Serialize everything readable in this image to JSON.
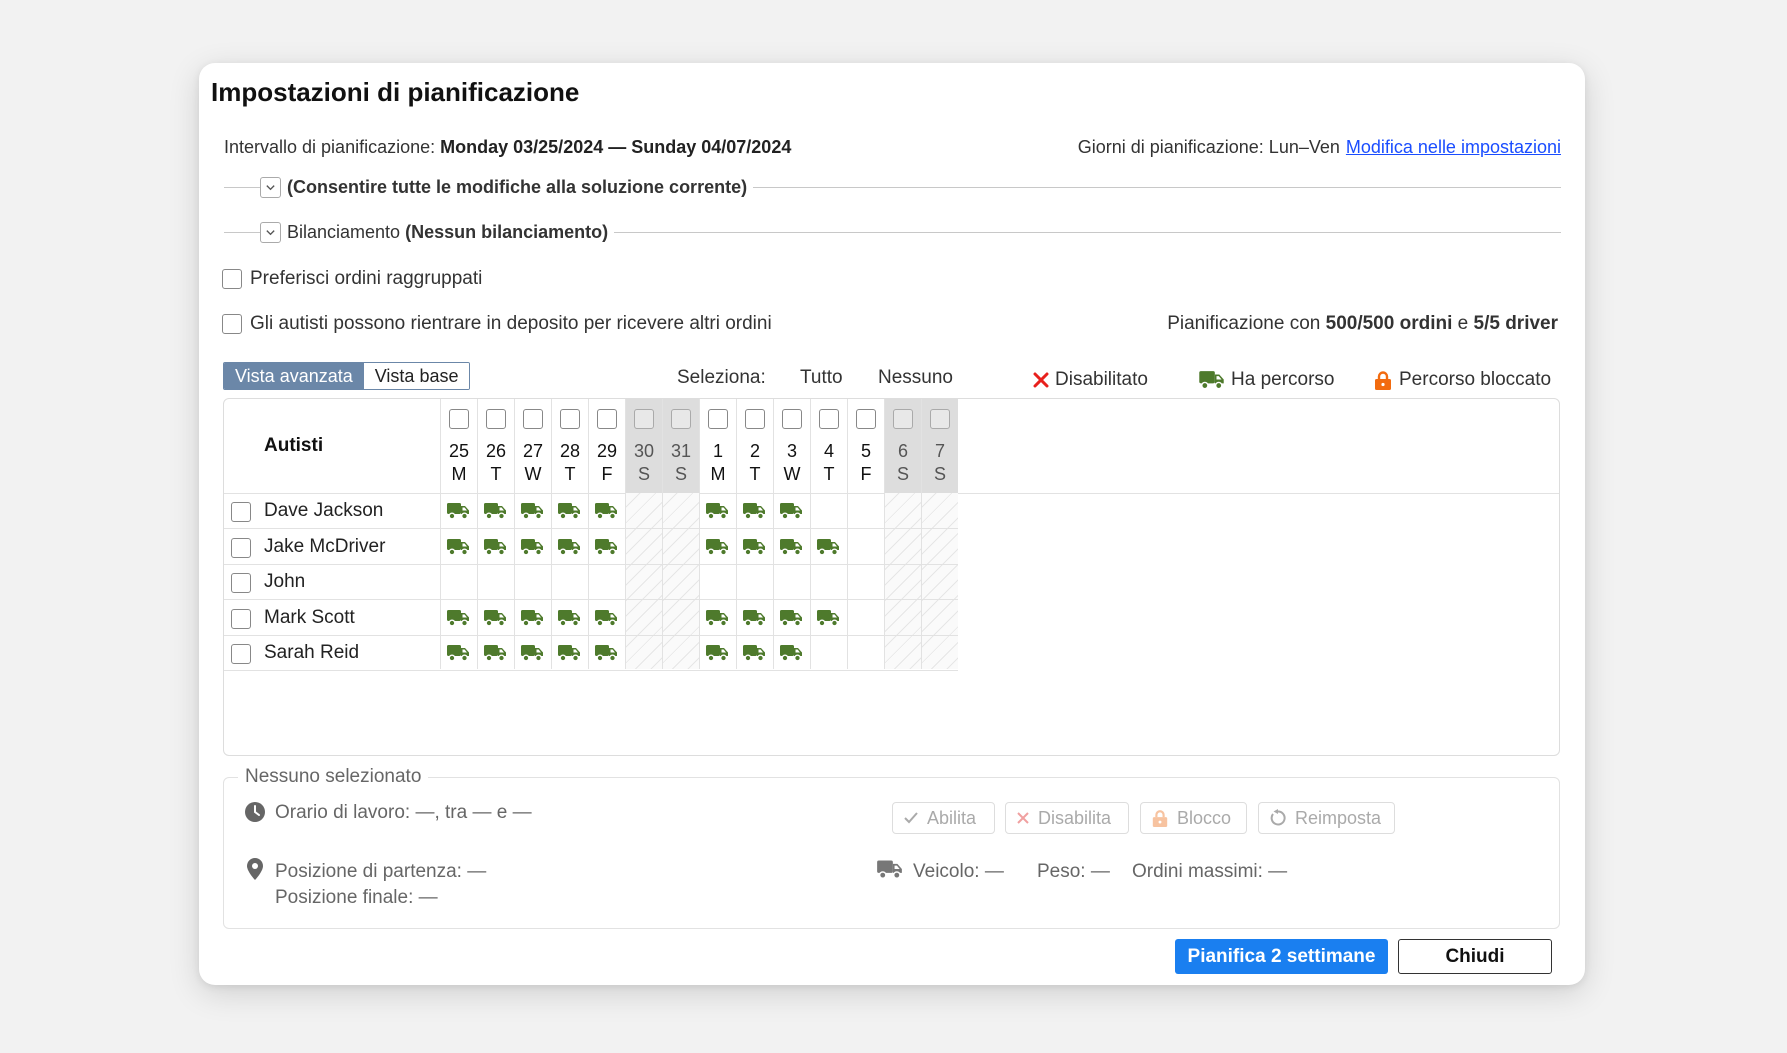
{
  "dialog": {
    "title": "Impostazioni di pianificazione",
    "interval_label": "Intervallo di pianificazione:",
    "interval_value": "Monday 03/25/2024 — Sunday 04/07/2024",
    "days_label": "Giorni di pianificazione: Lun–Ven",
    "edit_link": "Modifica nelle impostazioni"
  },
  "sections": {
    "changes": "(Consentire tutte le modifiche alla soluzione corrente)",
    "balancing_label": "Bilanciamento",
    "balancing_value": "(Nessun bilanciamento)"
  },
  "options": {
    "prefer_grouped": "Preferisci ordini raggruppati",
    "return_depot": "Gli autisti possono rientrare in deposito per ricevere altri ordini"
  },
  "stats": {
    "prefix": "Pianificazione con",
    "orders": "500/500 ordini",
    "conj": "e",
    "drivers": "5/5 driver"
  },
  "view_toggle": {
    "advanced": "Vista avanzata",
    "basic": "Vista base"
  },
  "select": {
    "label": "Seleziona:",
    "all": "Tutto",
    "none": "Nessuno"
  },
  "legend": {
    "disabled": "Disabilitato",
    "has_route": "Ha percorso",
    "locked_route": "Percorso bloccato"
  },
  "grid": {
    "drivers_header": "Autisti",
    "days": [
      {
        "num": "25",
        "letter": "M",
        "weekend": false
      },
      {
        "num": "26",
        "letter": "T",
        "weekend": false
      },
      {
        "num": "27",
        "letter": "W",
        "weekend": false
      },
      {
        "num": "28",
        "letter": "T",
        "weekend": false
      },
      {
        "num": "29",
        "letter": "F",
        "weekend": false
      },
      {
        "num": "30",
        "letter": "S",
        "weekend": true
      },
      {
        "num": "31",
        "letter": "S",
        "weekend": true
      },
      {
        "num": "1",
        "letter": "M",
        "weekend": false
      },
      {
        "num": "2",
        "letter": "T",
        "weekend": false
      },
      {
        "num": "3",
        "letter": "W",
        "weekend": false
      },
      {
        "num": "4",
        "letter": "T",
        "weekend": false
      },
      {
        "num": "5",
        "letter": "F",
        "weekend": false
      },
      {
        "num": "6",
        "letter": "S",
        "weekend": true
      },
      {
        "num": "7",
        "letter": "S",
        "weekend": true
      }
    ],
    "drivers": [
      {
        "name": "Dave Jackson",
        "routes": [
          0,
          1,
          2,
          3,
          4,
          7,
          8,
          9
        ]
      },
      {
        "name": "Jake McDriver",
        "routes": [
          0,
          1,
          2,
          3,
          4,
          7,
          8,
          9,
          10
        ]
      },
      {
        "name": "John",
        "routes": []
      },
      {
        "name": "Mark Scott",
        "routes": [
          0,
          1,
          2,
          3,
          4,
          7,
          8,
          9,
          10
        ]
      },
      {
        "name": "Sarah Reid",
        "routes": [
          0,
          1,
          2,
          3,
          4,
          7,
          8,
          9
        ]
      }
    ]
  },
  "selection": {
    "title": "Nessuno selezionato",
    "work_hours": "Orario di lavoro: —, tra — e —",
    "start_position": "Posizione di partenza: —",
    "end_position": "Posizione finale: —",
    "vehicle": "Veicolo: —",
    "weight": "Peso: —",
    "max_orders": "Ordini massimi: —",
    "btn_enable": "Abilita",
    "btn_disable": "Disabilita",
    "btn_lock": "Blocco",
    "btn_reset": "Reimposta"
  },
  "footer": {
    "plan": "Pianifica 2 settimane",
    "close": "Chiudi"
  },
  "colors": {
    "truck": "#4e7a2c",
    "primary": "#1a7ff0",
    "toggle_active": "#6b87a8",
    "disabled_x": "#e8201c",
    "lock": "#f26b0f",
    "link": "#1a4dff"
  }
}
